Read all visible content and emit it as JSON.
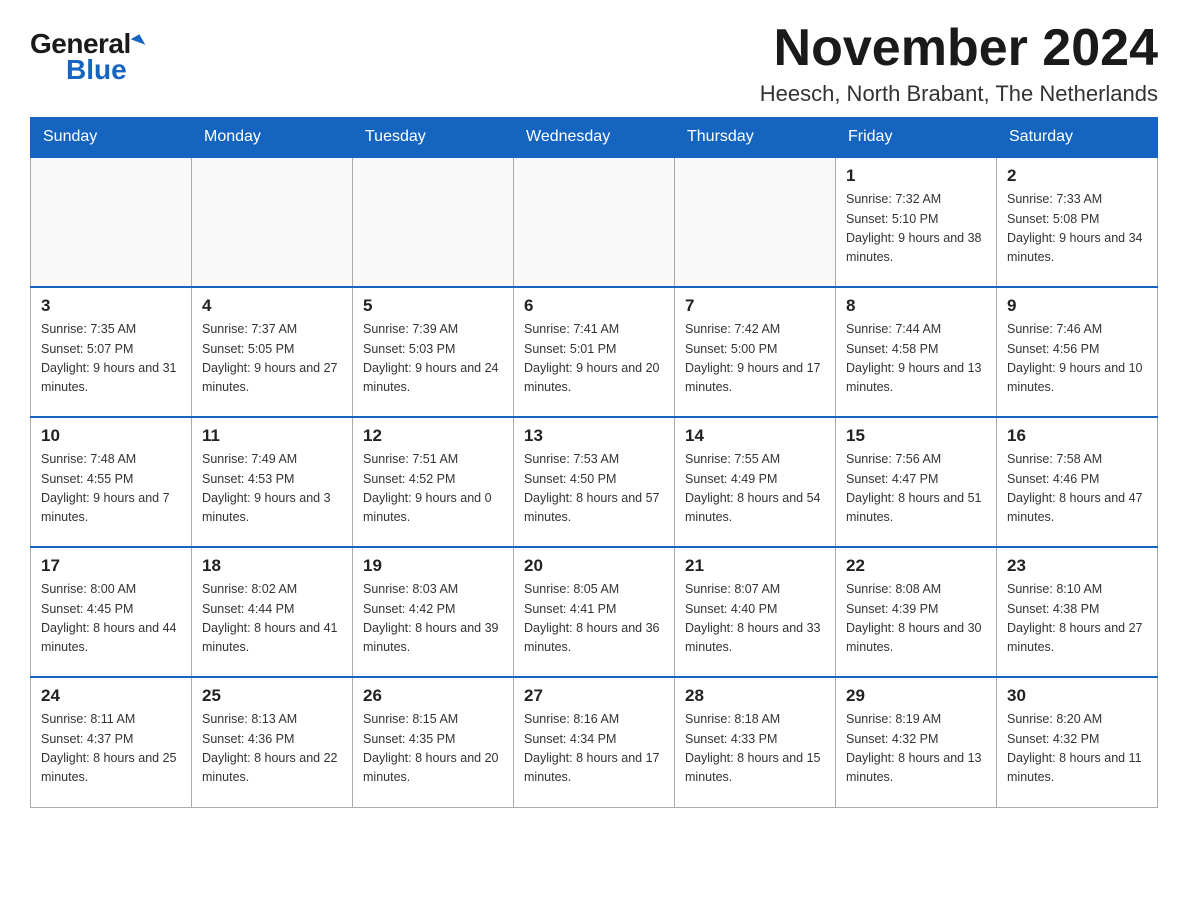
{
  "header": {
    "logo_general": "General",
    "logo_blue": "Blue",
    "month_title": "November 2024",
    "location": "Heesch, North Brabant, The Netherlands"
  },
  "weekdays": [
    "Sunday",
    "Monday",
    "Tuesday",
    "Wednesday",
    "Thursday",
    "Friday",
    "Saturday"
  ],
  "weeks": [
    [
      {
        "day": "",
        "sunrise": "",
        "sunset": "",
        "daylight": ""
      },
      {
        "day": "",
        "sunrise": "",
        "sunset": "",
        "daylight": ""
      },
      {
        "day": "",
        "sunrise": "",
        "sunset": "",
        "daylight": ""
      },
      {
        "day": "",
        "sunrise": "",
        "sunset": "",
        "daylight": ""
      },
      {
        "day": "",
        "sunrise": "",
        "sunset": "",
        "daylight": ""
      },
      {
        "day": "1",
        "sunrise": "Sunrise: 7:32 AM",
        "sunset": "Sunset: 5:10 PM",
        "daylight": "Daylight: 9 hours and 38 minutes."
      },
      {
        "day": "2",
        "sunrise": "Sunrise: 7:33 AM",
        "sunset": "Sunset: 5:08 PM",
        "daylight": "Daylight: 9 hours and 34 minutes."
      }
    ],
    [
      {
        "day": "3",
        "sunrise": "Sunrise: 7:35 AM",
        "sunset": "Sunset: 5:07 PM",
        "daylight": "Daylight: 9 hours and 31 minutes."
      },
      {
        "day": "4",
        "sunrise": "Sunrise: 7:37 AM",
        "sunset": "Sunset: 5:05 PM",
        "daylight": "Daylight: 9 hours and 27 minutes."
      },
      {
        "day": "5",
        "sunrise": "Sunrise: 7:39 AM",
        "sunset": "Sunset: 5:03 PM",
        "daylight": "Daylight: 9 hours and 24 minutes."
      },
      {
        "day": "6",
        "sunrise": "Sunrise: 7:41 AM",
        "sunset": "Sunset: 5:01 PM",
        "daylight": "Daylight: 9 hours and 20 minutes."
      },
      {
        "day": "7",
        "sunrise": "Sunrise: 7:42 AM",
        "sunset": "Sunset: 5:00 PM",
        "daylight": "Daylight: 9 hours and 17 minutes."
      },
      {
        "day": "8",
        "sunrise": "Sunrise: 7:44 AM",
        "sunset": "Sunset: 4:58 PM",
        "daylight": "Daylight: 9 hours and 13 minutes."
      },
      {
        "day": "9",
        "sunrise": "Sunrise: 7:46 AM",
        "sunset": "Sunset: 4:56 PM",
        "daylight": "Daylight: 9 hours and 10 minutes."
      }
    ],
    [
      {
        "day": "10",
        "sunrise": "Sunrise: 7:48 AM",
        "sunset": "Sunset: 4:55 PM",
        "daylight": "Daylight: 9 hours and 7 minutes."
      },
      {
        "day": "11",
        "sunrise": "Sunrise: 7:49 AM",
        "sunset": "Sunset: 4:53 PM",
        "daylight": "Daylight: 9 hours and 3 minutes."
      },
      {
        "day": "12",
        "sunrise": "Sunrise: 7:51 AM",
        "sunset": "Sunset: 4:52 PM",
        "daylight": "Daylight: 9 hours and 0 minutes."
      },
      {
        "day": "13",
        "sunrise": "Sunrise: 7:53 AM",
        "sunset": "Sunset: 4:50 PM",
        "daylight": "Daylight: 8 hours and 57 minutes."
      },
      {
        "day": "14",
        "sunrise": "Sunrise: 7:55 AM",
        "sunset": "Sunset: 4:49 PM",
        "daylight": "Daylight: 8 hours and 54 minutes."
      },
      {
        "day": "15",
        "sunrise": "Sunrise: 7:56 AM",
        "sunset": "Sunset: 4:47 PM",
        "daylight": "Daylight: 8 hours and 51 minutes."
      },
      {
        "day": "16",
        "sunrise": "Sunrise: 7:58 AM",
        "sunset": "Sunset: 4:46 PM",
        "daylight": "Daylight: 8 hours and 47 minutes."
      }
    ],
    [
      {
        "day": "17",
        "sunrise": "Sunrise: 8:00 AM",
        "sunset": "Sunset: 4:45 PM",
        "daylight": "Daylight: 8 hours and 44 minutes."
      },
      {
        "day": "18",
        "sunrise": "Sunrise: 8:02 AM",
        "sunset": "Sunset: 4:44 PM",
        "daylight": "Daylight: 8 hours and 41 minutes."
      },
      {
        "day": "19",
        "sunrise": "Sunrise: 8:03 AM",
        "sunset": "Sunset: 4:42 PM",
        "daylight": "Daylight: 8 hours and 39 minutes."
      },
      {
        "day": "20",
        "sunrise": "Sunrise: 8:05 AM",
        "sunset": "Sunset: 4:41 PM",
        "daylight": "Daylight: 8 hours and 36 minutes."
      },
      {
        "day": "21",
        "sunrise": "Sunrise: 8:07 AM",
        "sunset": "Sunset: 4:40 PM",
        "daylight": "Daylight: 8 hours and 33 minutes."
      },
      {
        "day": "22",
        "sunrise": "Sunrise: 8:08 AM",
        "sunset": "Sunset: 4:39 PM",
        "daylight": "Daylight: 8 hours and 30 minutes."
      },
      {
        "day": "23",
        "sunrise": "Sunrise: 8:10 AM",
        "sunset": "Sunset: 4:38 PM",
        "daylight": "Daylight: 8 hours and 27 minutes."
      }
    ],
    [
      {
        "day": "24",
        "sunrise": "Sunrise: 8:11 AM",
        "sunset": "Sunset: 4:37 PM",
        "daylight": "Daylight: 8 hours and 25 minutes."
      },
      {
        "day": "25",
        "sunrise": "Sunrise: 8:13 AM",
        "sunset": "Sunset: 4:36 PM",
        "daylight": "Daylight: 8 hours and 22 minutes."
      },
      {
        "day": "26",
        "sunrise": "Sunrise: 8:15 AM",
        "sunset": "Sunset: 4:35 PM",
        "daylight": "Daylight: 8 hours and 20 minutes."
      },
      {
        "day": "27",
        "sunrise": "Sunrise: 8:16 AM",
        "sunset": "Sunset: 4:34 PM",
        "daylight": "Daylight: 8 hours and 17 minutes."
      },
      {
        "day": "28",
        "sunrise": "Sunrise: 8:18 AM",
        "sunset": "Sunset: 4:33 PM",
        "daylight": "Daylight: 8 hours and 15 minutes."
      },
      {
        "day": "29",
        "sunrise": "Sunrise: 8:19 AM",
        "sunset": "Sunset: 4:32 PM",
        "daylight": "Daylight: 8 hours and 13 minutes."
      },
      {
        "day": "30",
        "sunrise": "Sunrise: 8:20 AM",
        "sunset": "Sunset: 4:32 PM",
        "daylight": "Daylight: 8 hours and 11 minutes."
      }
    ]
  ]
}
